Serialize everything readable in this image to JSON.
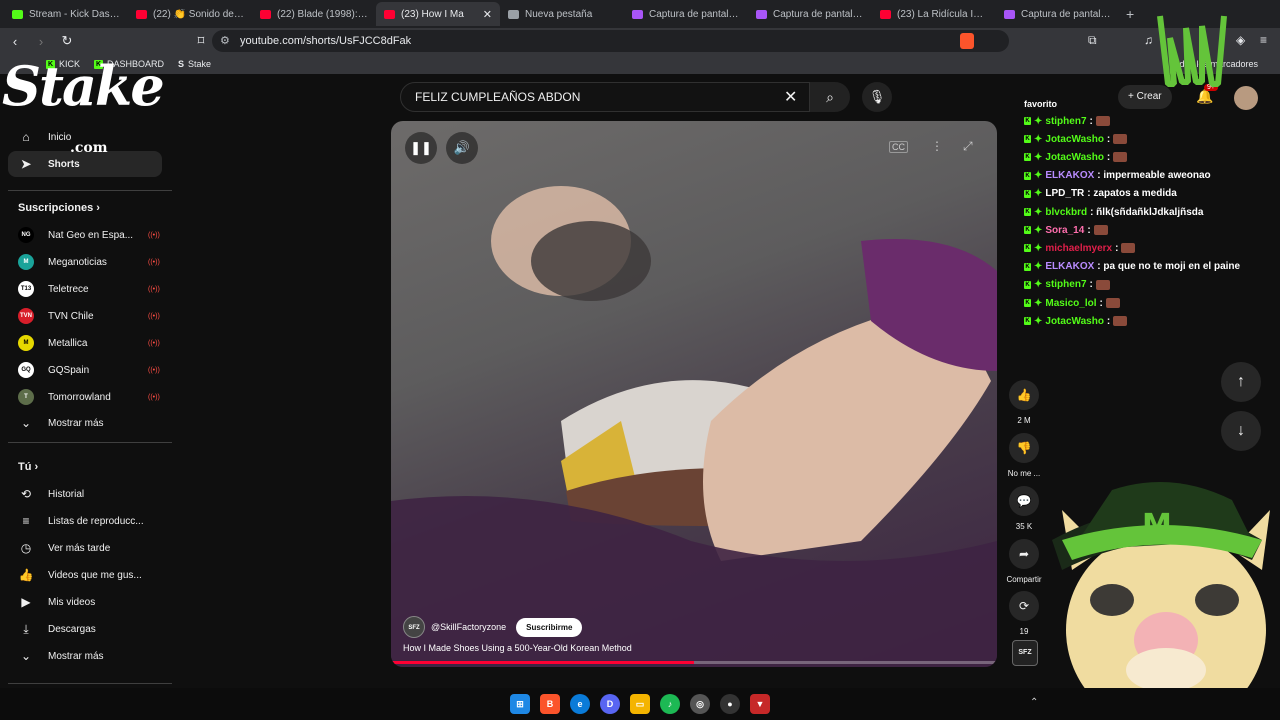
{
  "tabs": [
    {
      "title": "Stream - Kick Dashbo",
      "color": "#53fc18"
    },
    {
      "title": "(22) 👏 Sonido de apl",
      "color": "#ff0033"
    },
    {
      "title": "(22) Blade (1998): Bla",
      "color": "#ff0033"
    },
    {
      "title": "(23) How I Ma",
      "color": "#ff0033",
      "active": true
    },
    {
      "title": "Nueva pestaña",
      "color": "#9aa0a6"
    },
    {
      "title": "Captura de pantalla p",
      "color": "#a855f7"
    },
    {
      "title": "Captura de pantalla p",
      "color": "#a855f7"
    },
    {
      "title": "(23) La Ridícula Ingen",
      "color": "#ff0033"
    },
    {
      "title": "Captura de pantalla p",
      "color": "#a855f7"
    }
  ],
  "address": {
    "url": "youtube.com/shorts/UsFJCC8dFak"
  },
  "bookmarks": {
    "kick": "KICK",
    "dashboard": "DASHBOARD",
    "stake": "Stake",
    "all": "Todos los marcadores"
  },
  "overlay": {
    "stake_logo": "Stake",
    "stake_com": ".com"
  },
  "header": {
    "search_value": "FELIZ CUMPLEAÑOS ABDON",
    "create_label": "Crear",
    "notif_badge": "9+"
  },
  "sidebar": {
    "nav": [
      {
        "label": "Inicio"
      },
      {
        "label": "Shorts"
      }
    ],
    "subs_title": "Suscripciones",
    "subs": [
      {
        "name": "Nat Geo en Espa...",
        "color": "#000000",
        "abbr": "NG"
      },
      {
        "name": "Meganoticias",
        "color": "#1aa39a",
        "abbr": "M"
      },
      {
        "name": "Teletrece",
        "color": "#ffffff",
        "abbr": "T13"
      },
      {
        "name": "TVN Chile",
        "color": "#d81e2a",
        "abbr": "TVN"
      },
      {
        "name": "Metallica",
        "color": "#e6d800",
        "abbr": "M"
      },
      {
        "name": "GQSpain",
        "color": "#ffffff",
        "abbr": "GQ"
      },
      {
        "name": "Tomorrowland",
        "color": "#5d6d4a",
        "abbr": "T"
      }
    ],
    "show_more": "Mostrar más",
    "you_title": "Tú",
    "you": [
      {
        "label": "Historial"
      },
      {
        "label": "Listas de reproducc..."
      },
      {
        "label": "Ver más tarde"
      },
      {
        "label": "Videos que me gus..."
      },
      {
        "label": "Mis videos"
      },
      {
        "label": "Descargas"
      },
      {
        "label": "Mostrar más"
      }
    ]
  },
  "video": {
    "channel": "@SkillFactoryzone",
    "channel_logo": "SFZ",
    "subscribe": "Suscribirme",
    "title": "How I Made Shoes Using a 500-Year-Old Korean Method",
    "progress": 0.5
  },
  "actions": {
    "likes": "2 M",
    "dislike": "No me ...",
    "comments": "35 K",
    "share": "Compartir",
    "remix": "19"
  },
  "chat": {
    "intro": "favorito",
    "messages": [
      {
        "user": "stiphen7",
        "text": ":",
        "color": "#53fc18",
        "emote": true
      },
      {
        "user": "JotacWasho",
        "text": ":",
        "color": "#53fc18",
        "emote": true
      },
      {
        "user": "JotacWasho",
        "text": ":",
        "color": "#53fc18",
        "emote": true
      },
      {
        "user": "ELKAKOX",
        "text": ": impermeable aweonao",
        "color": "#b98cff"
      },
      {
        "user": "LPD_TR",
        "text": ": zapatos a medida",
        "color": "#ffffff"
      },
      {
        "user": "blvckbrd",
        "text": ": ñlk(sñdañklJdkaljñsda",
        "color": "#53fc18"
      },
      {
        "user": "Sora_14",
        "text": ":",
        "color": "#ff6fae",
        "emote": true
      },
      {
        "user": "michaelmyerx",
        "text": ":",
        "color": "#e01f4a",
        "emote": true
      },
      {
        "user": "ELKAKOX",
        "text": ": pa que no te moji en el paine",
        "color": "#b98cff"
      },
      {
        "user": "stiphen7",
        "text": ":",
        "color": "#53fc18",
        "emote": true
      },
      {
        "user": "Masico_lol",
        "text": ":",
        "color": "#53fc18",
        "emote": true
      },
      {
        "user": "JotacWasho",
        "text": ":",
        "color": "#53fc18",
        "emote": true
      }
    ]
  },
  "colors": {
    "brand_red": "#ff0033",
    "kick_green": "#53fc18",
    "bg": "#0f0f0f"
  }
}
